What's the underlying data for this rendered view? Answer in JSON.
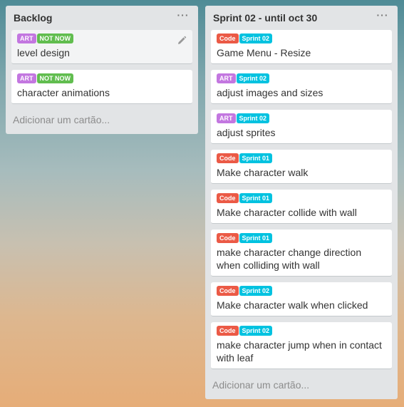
{
  "colors": {
    "art": "#c377e0",
    "not_now": "#61bd4f",
    "code": "#eb5a46",
    "sprint": "#00c2e0"
  },
  "lists": [
    {
      "title": "Backlog",
      "menu_icon": "ellipsis-icon",
      "add_card": "Adicionar um cartão...",
      "cards": [
        {
          "labels": [
            {
              "text": "ART",
              "kind": "art"
            },
            {
              "text": "NOT NOW",
              "kind": "not_now"
            }
          ],
          "title": "level design",
          "hover": true
        },
        {
          "labels": [
            {
              "text": "ART",
              "kind": "art"
            },
            {
              "text": "NOT NOW",
              "kind": "not_now"
            }
          ],
          "title": "character animations"
        }
      ]
    },
    {
      "title": "Sprint 02 - until oct 30",
      "menu_icon": "ellipsis-icon",
      "add_card": "Adicionar um cartão...",
      "cards": [
        {
          "labels": [
            {
              "text": "Code",
              "kind": "code"
            },
            {
              "text": "Sprint 02",
              "kind": "sprint"
            }
          ],
          "title": "Game Menu - Resize"
        },
        {
          "labels": [
            {
              "text": "ART",
              "kind": "art"
            },
            {
              "text": "Sprint 02",
              "kind": "sprint"
            }
          ],
          "title": "adjust images and sizes"
        },
        {
          "labels": [
            {
              "text": "ART",
              "kind": "art"
            },
            {
              "text": "Sprint 02",
              "kind": "sprint"
            }
          ],
          "title": "adjust sprites"
        },
        {
          "labels": [
            {
              "text": "Code",
              "kind": "code"
            },
            {
              "text": "Sprint 01",
              "kind": "sprint"
            }
          ],
          "title": "Make character walk"
        },
        {
          "labels": [
            {
              "text": "Code",
              "kind": "code"
            },
            {
              "text": "Sprint 01",
              "kind": "sprint"
            }
          ],
          "title": "Make character collide with wall"
        },
        {
          "labels": [
            {
              "text": "Code",
              "kind": "code"
            },
            {
              "text": "Sprint 01",
              "kind": "sprint"
            }
          ],
          "title": "make character change direction when colliding with wall"
        },
        {
          "labels": [
            {
              "text": "Code",
              "kind": "code"
            },
            {
              "text": "Sprint 02",
              "kind": "sprint"
            }
          ],
          "title": "Make character walk when clicked"
        },
        {
          "labels": [
            {
              "text": "Code",
              "kind": "code"
            },
            {
              "text": "Sprint 02",
              "kind": "sprint"
            }
          ],
          "title": "make character jump when in contact with leaf"
        }
      ]
    }
  ]
}
